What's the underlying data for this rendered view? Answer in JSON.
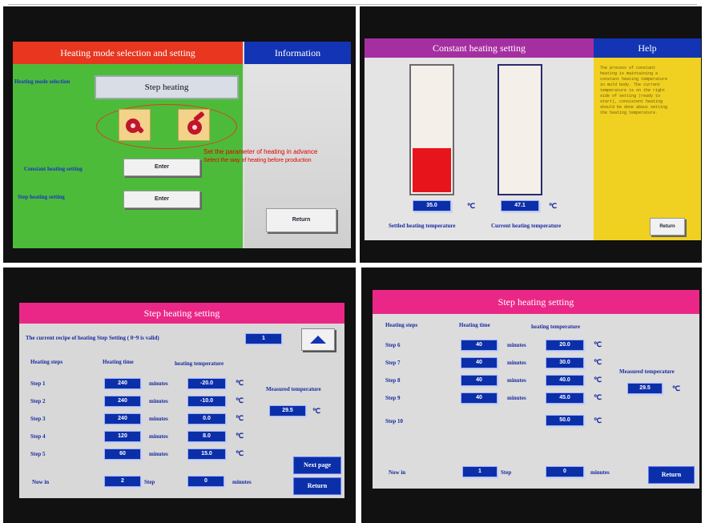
{
  "panel1": {
    "header_title": "Heating mode selection and  setting",
    "info_title": "Information",
    "mode_label": "Heating mode selection",
    "mode_value": "Step heating",
    "constant_label": "Constant heating setting",
    "constant_button": "Enter",
    "step_label": "Step heating setting",
    "step_button": "Enter",
    "return_button": "Return",
    "annotation_line1": "Set the parameter of heating in advance",
    "annotation_line2": "Select the way of heating before production"
  },
  "panel2": {
    "header_title": "Constant heating setting",
    "help_title": "Help",
    "help_text": "The process of constant heating is maintaining a constant heating temperature in mold body. The current temperature is on the right side of setting (ready to start), consistent heating should be done about setting the heating temperature.",
    "set_value": "35.0",
    "current_value": "47.1",
    "unit": "℃",
    "set_label": "Settled heating temperature",
    "current_label": "Current heating temperature",
    "return_button": "Return",
    "set_fill_fraction": 0.35,
    "current_fill_fraction": 0
  },
  "panel3": {
    "header_title": "Step heating  setting",
    "recipe_label": "The current  recipe of heating Step Setting  ( 0~9 is valid)",
    "recipe_value": "1",
    "col_steps": "Heating steps",
    "col_time": "Heating time",
    "col_temp": "heating  temperature",
    "minutes_label": "minutes",
    "unit": "℃",
    "rows": [
      {
        "step": "Step 1",
        "time": "240",
        "temp": "-20.0"
      },
      {
        "step": "Step 2",
        "time": "240",
        "temp": "-10.0"
      },
      {
        "step": "Step 3",
        "time": "240",
        "temp": "0.0"
      },
      {
        "step": "Step 4",
        "time": "120",
        "temp": "8.0"
      },
      {
        "step": "Step 5",
        "time": "60",
        "temp": "15.0"
      }
    ],
    "measured_label": "Measured temperature",
    "measured_value": "29.5",
    "now_label": "Now in",
    "now_step": "2",
    "step_word": "Step",
    "now_minutes": "0",
    "next_button": "Next page",
    "return_button": "Return"
  },
  "panel4": {
    "header_title": "Step heating  setting",
    "col_steps": "Heating steps",
    "col_time": "Heating time",
    "col_temp": "heating  temperature",
    "minutes_label": "minutes",
    "unit": "℃",
    "rows": [
      {
        "step": "Step 6",
        "time": "40",
        "temp": "20.0"
      },
      {
        "step": "Step 7",
        "time": "40",
        "temp": "30.0"
      },
      {
        "step": "Step 8",
        "time": "40",
        "temp": "40.0"
      },
      {
        "step": "Step 9",
        "time": "40",
        "temp": "45.0"
      }
    ],
    "step10": {
      "step": "Step 10",
      "temp": "50.0"
    },
    "measured_label": "Measured temperature",
    "measured_value": "29.5",
    "now_label": "Now in",
    "now_step": "1",
    "step_word": "Step",
    "now_minutes": "0",
    "return_button": "Return"
  }
}
